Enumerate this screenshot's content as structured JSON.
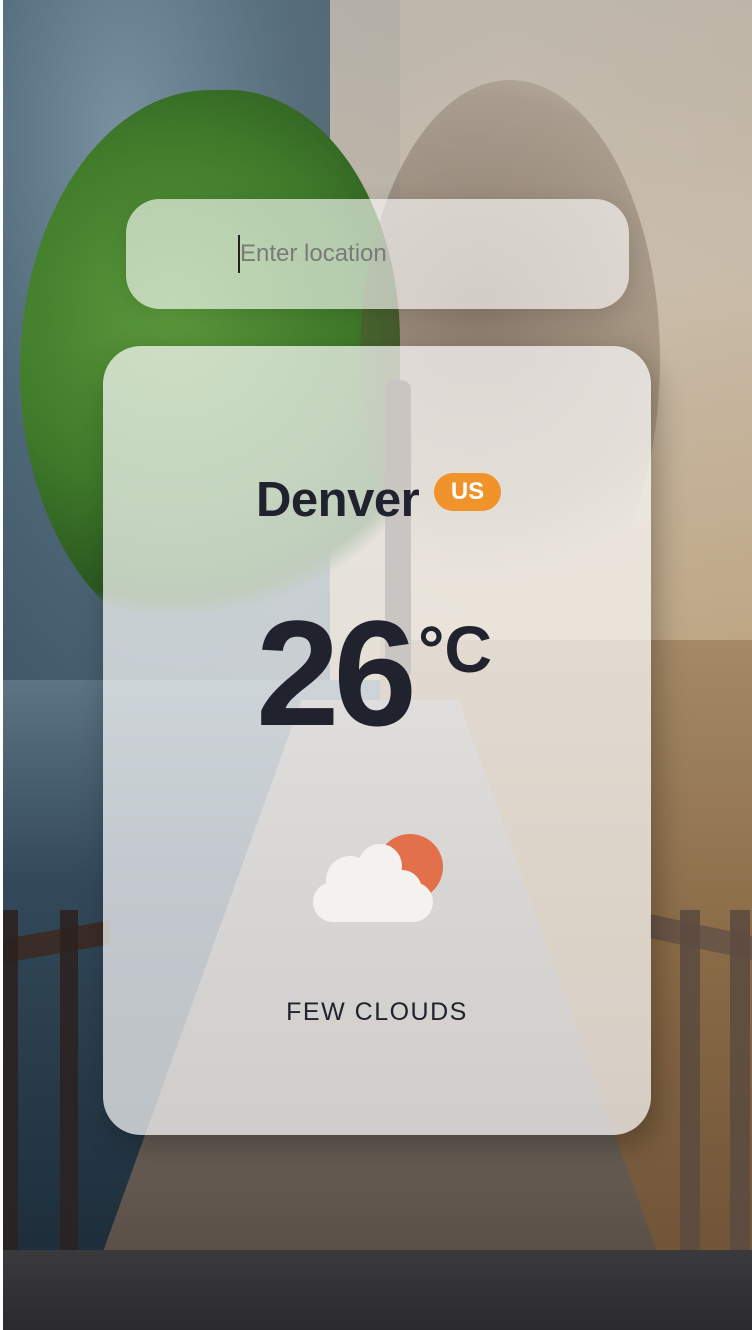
{
  "search": {
    "value": "",
    "placeholder": "Enter location"
  },
  "weather": {
    "city": "Denver",
    "country": "US",
    "temperature": "26",
    "unit": "°C",
    "description": "FEW CLOUDS",
    "icon": "few-clouds-icon"
  },
  "colors": {
    "accent": "#f0932b",
    "text": "#20222e",
    "sun": "#e2704a",
    "cloud": "#f4f2ef"
  }
}
